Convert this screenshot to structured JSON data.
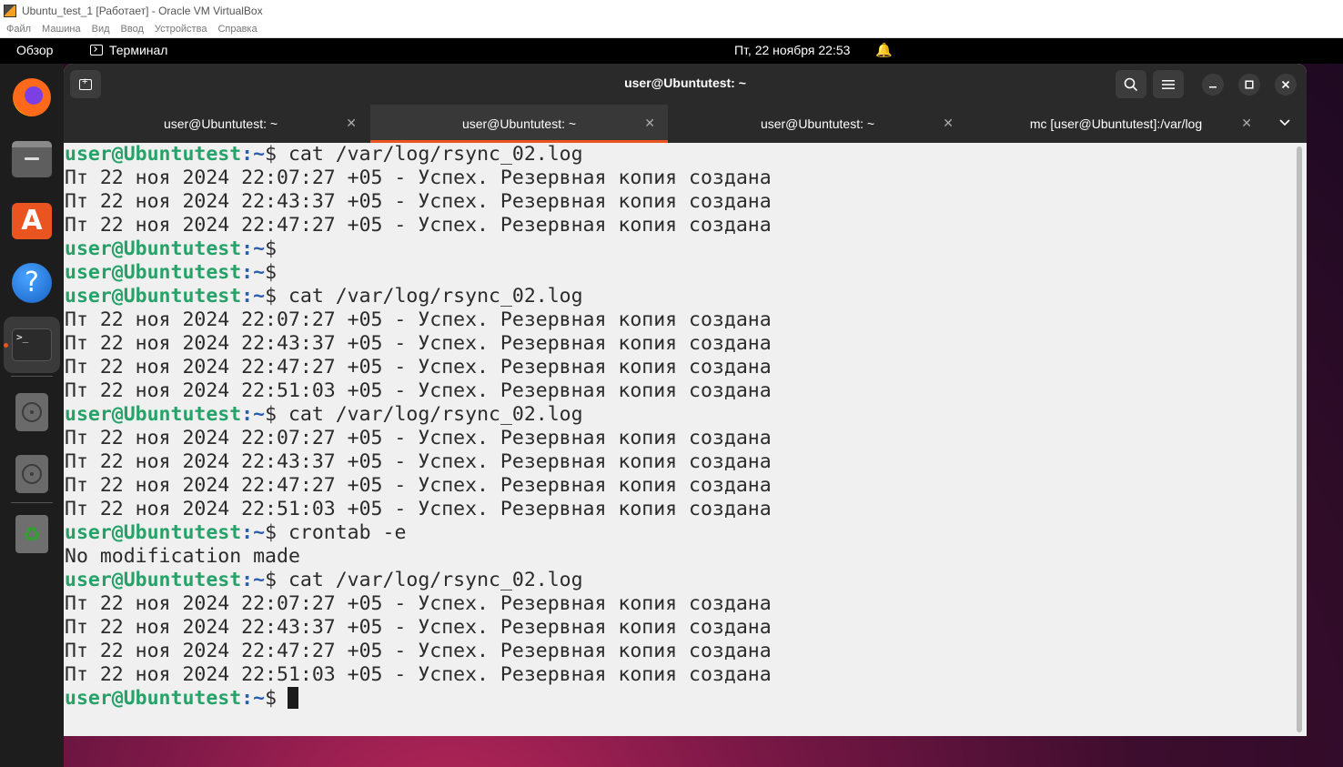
{
  "vbox": {
    "title": "Ubuntu_test_1 [Работает] - Oracle VM VirtualBox",
    "menu": [
      "Файл",
      "Машина",
      "Вид",
      "Ввод",
      "Устройства",
      "Справка"
    ]
  },
  "topbar": {
    "overview": "Обзор",
    "app_name": "Терминал",
    "clock": "Пт, 22 ноября  22:53"
  },
  "dock": {
    "items": [
      "firefox-icon",
      "files-icon",
      "app-center-icon",
      "help-icon",
      "terminal-icon",
      "disc-icon",
      "disc-icon",
      "trash-icon"
    ]
  },
  "terminal": {
    "window_title": "user@Ubuntutest: ~",
    "tabs": [
      {
        "label": "user@Ubuntutest: ~",
        "active": false
      },
      {
        "label": "user@Ubuntutest: ~",
        "active": true
      },
      {
        "label": "user@Ubuntutest: ~",
        "active": false
      },
      {
        "label": "mc [user@Ubuntutest]:/var/log",
        "active": false
      }
    ],
    "prompt": {
      "user": "user@Ubuntutest",
      "path": ":~",
      "symbol": "$"
    },
    "lines": [
      {
        "type": "prompt",
        "cmd": " cat /var/log/rsync_02.log"
      },
      {
        "type": "out",
        "text": "Пт 22 ноя 2024 22:07:27 +05 - Успех. Резервная копия создана"
      },
      {
        "type": "out",
        "text": "Пт 22 ноя 2024 22:43:37 +05 - Успех. Резервная копия создана"
      },
      {
        "type": "out",
        "text": "Пт 22 ноя 2024 22:47:27 +05 - Успех. Резервная копия создана"
      },
      {
        "type": "prompt",
        "cmd": ""
      },
      {
        "type": "prompt",
        "cmd": ""
      },
      {
        "type": "prompt",
        "cmd": " cat /var/log/rsync_02.log"
      },
      {
        "type": "out",
        "text": "Пт 22 ноя 2024 22:07:27 +05 - Успех. Резервная копия создана"
      },
      {
        "type": "out",
        "text": "Пт 22 ноя 2024 22:43:37 +05 - Успех. Резервная копия создана"
      },
      {
        "type": "out",
        "text": "Пт 22 ноя 2024 22:47:27 +05 - Успех. Резервная копия создана"
      },
      {
        "type": "out",
        "text": "Пт 22 ноя 2024 22:51:03 +05 - Успех. Резервная копия создана"
      },
      {
        "type": "prompt",
        "cmd": " cat /var/log/rsync_02.log"
      },
      {
        "type": "out",
        "text": "Пт 22 ноя 2024 22:07:27 +05 - Успех. Резервная копия создана"
      },
      {
        "type": "out",
        "text": "Пт 22 ноя 2024 22:43:37 +05 - Успех. Резервная копия создана"
      },
      {
        "type": "out",
        "text": "Пт 22 ноя 2024 22:47:27 +05 - Успех. Резервная копия создана"
      },
      {
        "type": "out",
        "text": "Пт 22 ноя 2024 22:51:03 +05 - Успех. Резервная копия создана"
      },
      {
        "type": "prompt",
        "cmd": " crontab -e"
      },
      {
        "type": "out",
        "text": "No modification made"
      },
      {
        "type": "prompt",
        "cmd": " cat /var/log/rsync_02.log"
      },
      {
        "type": "out",
        "text": "Пт 22 ноя 2024 22:07:27 +05 - Успех. Резервная копия создана"
      },
      {
        "type": "out",
        "text": "Пт 22 ноя 2024 22:43:37 +05 - Успех. Резервная копия создана"
      },
      {
        "type": "out",
        "text": "Пт 22 ноя 2024 22:47:27 +05 - Успех. Резервная копия создана"
      },
      {
        "type": "out",
        "text": "Пт 22 ноя 2024 22:51:03 +05 - Успех. Резервная копия создана",
        "highlight": true
      },
      {
        "type": "prompt",
        "cmd": "",
        "cursor": true
      }
    ],
    "colors": {
      "prompt_user": "#26a269",
      "prompt_path": "#2a5fb0",
      "highlight": "#f3e82a",
      "accent": "#e95420"
    }
  }
}
